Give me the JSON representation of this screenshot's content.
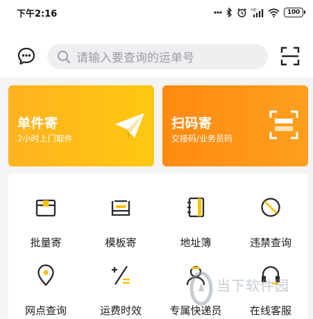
{
  "status_bar": {
    "time": "下午2:16",
    "battery": "100",
    "icons": [
      "dots-icon",
      "bluetooth-icon",
      "alarm-icon",
      "signal-icon",
      "wifi-icon",
      "battery-icon"
    ]
  },
  "header": {
    "search_placeholder": "请输入要查询的运单号",
    "left_icon": "chat-icon",
    "right_icon": "scan-icon"
  },
  "cards": [
    {
      "title": "单件寄",
      "subtitle": "2小时上门取件",
      "icon": "paper-plane-icon",
      "color": "#ffb21f"
    },
    {
      "title": "扫码寄",
      "subtitle": "交接码/业务员码",
      "icon": "scan-frame-icon",
      "color": "#ff8a12"
    }
  ],
  "grid": [
    {
      "label": "批量寄",
      "icon": "box-icon"
    },
    {
      "label": "模板寄",
      "icon": "template-icon"
    },
    {
      "label": "地址簿",
      "icon": "address-book-icon"
    },
    {
      "label": "违禁查询",
      "icon": "prohibited-icon"
    },
    {
      "label": "网点查询",
      "icon": "location-pin-icon"
    },
    {
      "label": "运费时效",
      "icon": "fee-calc-icon"
    },
    {
      "label": "专属快递员",
      "icon": "courier-icon"
    },
    {
      "label": "在线客服",
      "icon": "headset-icon"
    }
  ],
  "watermark": {
    "text": "当下软件园"
  },
  "colors": {
    "accent": "#ffb300",
    "icon_dark": "#2a2a2a",
    "icon_accent": "#ffc107"
  }
}
